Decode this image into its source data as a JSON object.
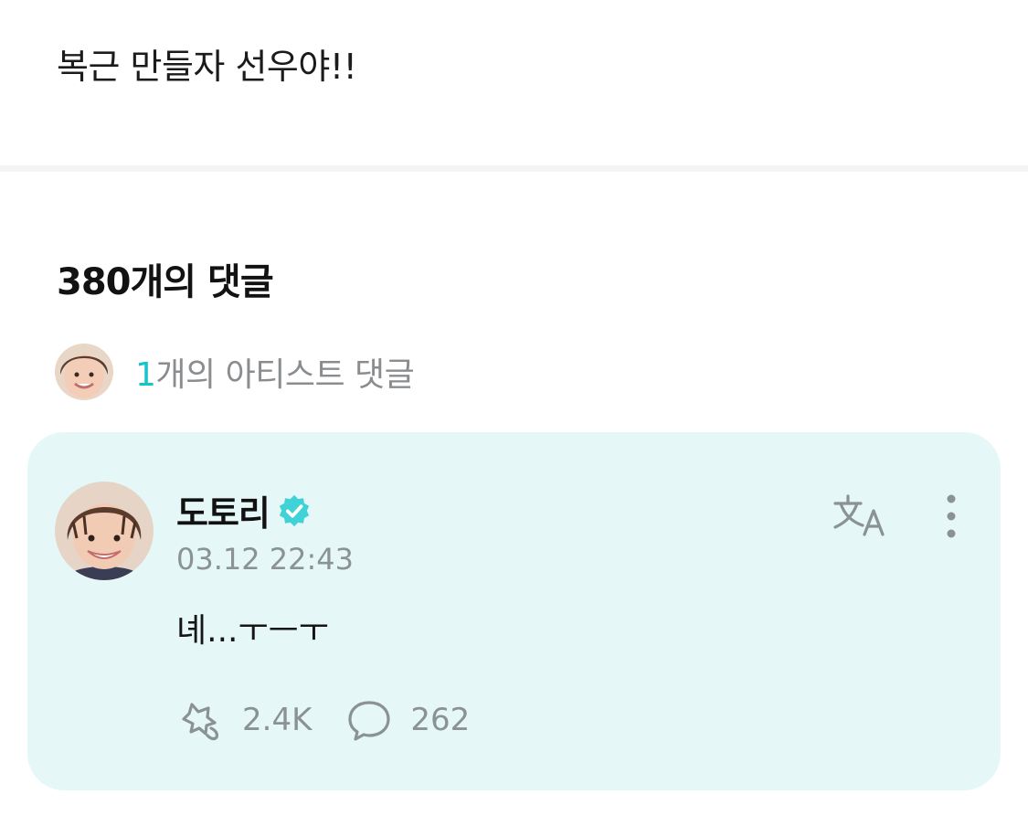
{
  "post": {
    "text": "복근 만들자 선우야!!"
  },
  "comments": {
    "title": "380개의 댓글",
    "artist_summary": {
      "count": "1",
      "label": "개의 아티스트 댓글"
    }
  },
  "comment": {
    "username": "도토리",
    "timestamp": "03.12 22:43",
    "body": "녜...ㅜㅡㅜ",
    "likes": "2.4K",
    "replies": "262"
  },
  "icons": {
    "verified": "verified-badge-icon",
    "translate": "translate-icon",
    "more": "more-vertical-icon",
    "like": "like-icon",
    "reply": "reply-bubble-icon"
  },
  "colors": {
    "accent": "#17c5c9",
    "card_bg": "#e5f8f7",
    "muted": "#8b9293"
  }
}
